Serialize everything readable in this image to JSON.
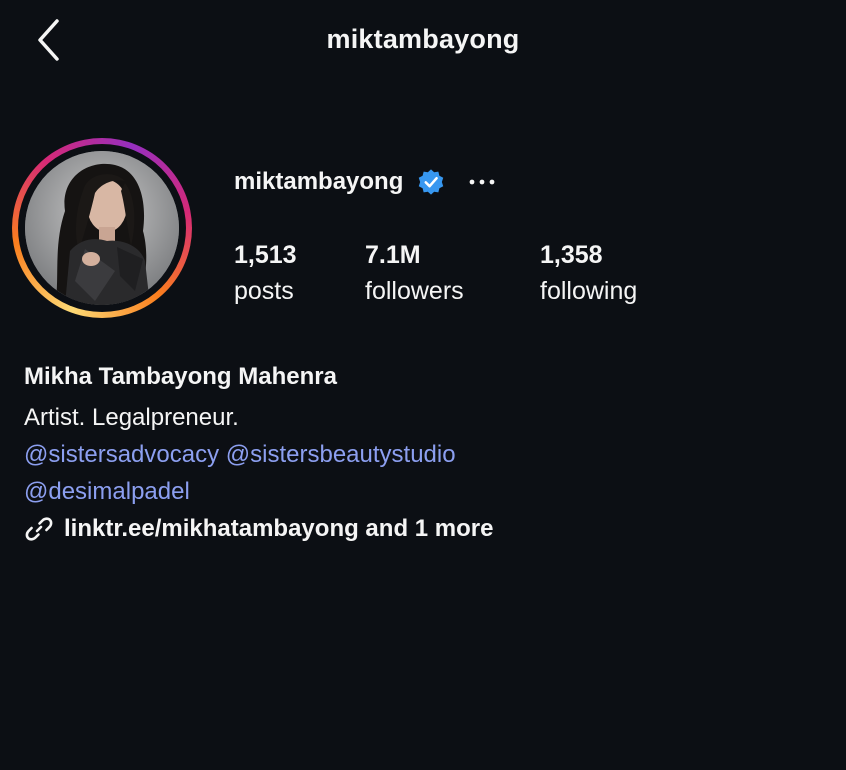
{
  "header": {
    "title": "miktambayong",
    "back_icon": "chevron-left-icon"
  },
  "profile": {
    "username": "miktambayong",
    "verified_icon": "verified-badge-icon",
    "verified_color": "#3797f0",
    "more_icon": "more-horizontal-icon",
    "avatar_ring_colors": [
      "#feda75",
      "#fa7e1e",
      "#d62976",
      "#962fbf"
    ]
  },
  "stats": [
    {
      "value": "1,513",
      "label": "posts"
    },
    {
      "value": "7.1M",
      "label": "followers"
    },
    {
      "value": "1,358",
      "label": "following"
    }
  ],
  "bio": {
    "full_name": "Mikha Tambayong Mahenra",
    "description": "Artist. Legalpreneur.",
    "mentions": [
      "@sistersadvocacy",
      "@sistersbeautystudio",
      "@desimalpadel"
    ],
    "mention_color": "#8c9ff0",
    "link_icon": "link-icon",
    "link_text": "linktr.ee/mikhatambayong and 1 more"
  },
  "theme": {
    "background": "#0c0f14",
    "text": "#f5f5f5"
  }
}
